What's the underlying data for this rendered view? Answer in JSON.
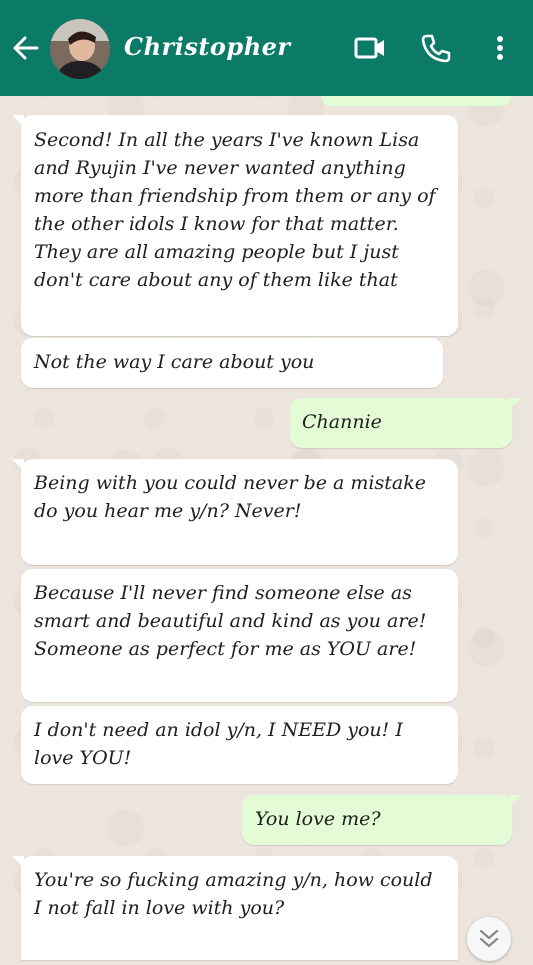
{
  "header": {
    "contact_name": "Christopher",
    "icons": [
      "back-arrow-icon",
      "video-call-icon",
      "voice-call-icon",
      "more-vert-icon"
    ],
    "color": "#0b7a66"
  },
  "messages": [
    {
      "dir": "in",
      "text": "Second! In all the years I've known Lisa and Ryujin I've never wanted anything more than friendship from them or any of the other idols I know for that matter. They are all amazing people but I just don't care about any of them like that"
    },
    {
      "dir": "in",
      "text": "Not the way I care about you"
    },
    {
      "dir": "out",
      "text": "Channie"
    },
    {
      "dir": "in",
      "text": "Being with you could never be a mistake do you hear me y/n? Never!"
    },
    {
      "dir": "in",
      "text": "Because I'll never find someone else as smart and beautiful and kind as you are! Someone as perfect for me as YOU are!"
    },
    {
      "dir": "in",
      "text": "I don't need an idol y/n, I NEED you! I love YOU!"
    },
    {
      "dir": "out",
      "text": "You love me?"
    },
    {
      "dir": "in",
      "text": "You're so fucking amazing y/n, how could I not fall in love with you?"
    }
  ],
  "scroll_icon": "double-chevron-down-icon"
}
